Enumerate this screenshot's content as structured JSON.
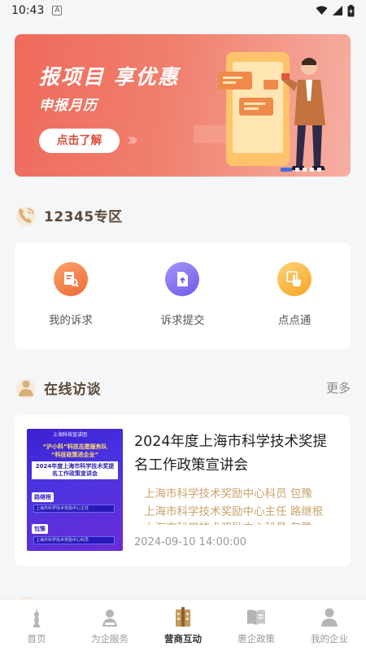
{
  "status_bar": {
    "time": "10:43",
    "notification_icon": "A"
  },
  "banner": {
    "title": "报项目 享优惠",
    "subtitle": "申报月历",
    "button": "点击了解",
    "arrows": "»",
    "slide_count": 5,
    "active_slide": 1
  },
  "section_12345": {
    "title": "12345专区",
    "items": [
      {
        "label": "我的诉求",
        "icon": "document-search-icon",
        "color": "#f07a3a"
      },
      {
        "label": "诉求提交",
        "icon": "file-upload-icon",
        "color": "#7d6cf0"
      },
      {
        "label": "点点通",
        "icon": "hand-tap-icon",
        "color": "#f5a623"
      }
    ]
  },
  "section_interview": {
    "title": "在线访谈",
    "more": "更多",
    "item": {
      "title": "2024年度上海市科学技术奖提名工作政策宣讲会",
      "speakers": [
        "上海市科学技术奖励中心科员 包豫",
        "上海市科学技术奖励中心主任 路继根",
        "上海市科学技术奖励中心科员 包豫"
      ],
      "date": "2024-09-10 14:00:00",
      "thumbnail": {
        "brand": "上海科技宣讲团",
        "tag_line": "“沪小科”科技志愿服务队",
        "slogan": "“科技政策进企业”",
        "heading": "2024年度上海市科学技术奖提名工作政策宣讲会",
        "label_speaker": "路继根",
        "label_speaker_role": "上海市科学技术奖励中心主任",
        "label_speaker2": "包豫",
        "label_speaker2_role": "上海市科学技术奖励中心科员"
      }
    }
  },
  "bottom_nav": {
    "items": [
      {
        "label": "首页",
        "icon": "tower-icon",
        "active": false
      },
      {
        "label": "为企服务",
        "icon": "service-person-icon",
        "active": false
      },
      {
        "label": "营商互动",
        "icon": "building-icon",
        "active": true
      },
      {
        "label": "惠企政策",
        "icon": "policy-book-icon",
        "active": false
      },
      {
        "label": "我的企业",
        "icon": "user-icon",
        "active": false
      }
    ]
  }
}
